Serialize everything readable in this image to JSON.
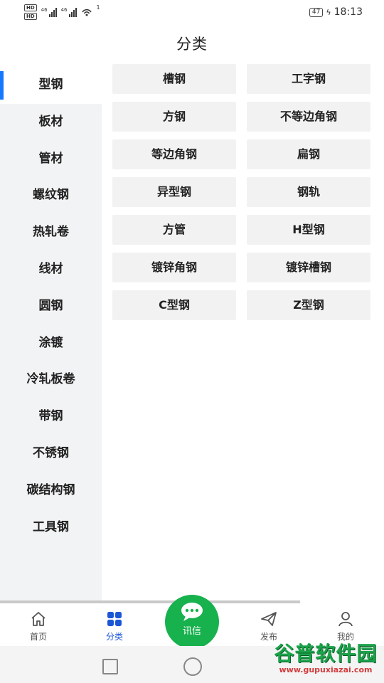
{
  "status_bar": {
    "hd1": "HD",
    "hd2": "HD",
    "sim1": "46",
    "sim2": "46",
    "wifi_badge": "1",
    "battery": "47",
    "time": "18:13"
  },
  "header": {
    "title": "分类"
  },
  "sidebar": {
    "items": [
      {
        "label": "型钢",
        "active": true
      },
      {
        "label": "板材"
      },
      {
        "label": "管材"
      },
      {
        "label": "螺纹钢"
      },
      {
        "label": "热轧卷"
      },
      {
        "label": "线材"
      },
      {
        "label": "圆钢"
      },
      {
        "label": "涂镀"
      },
      {
        "label": "冷轧板卷"
      },
      {
        "label": "带钢"
      },
      {
        "label": "不锈钢"
      },
      {
        "label": "碳结构钢"
      },
      {
        "label": "工具钢"
      }
    ]
  },
  "subcategories": [
    "槽钢",
    "工字钢",
    "方钢",
    "不等边角钢",
    "等边角钢",
    "扁钢",
    "异型钢",
    "钢轨",
    "方管",
    "H型钢",
    "镀锌角钢",
    "镀锌槽钢",
    "C型钢",
    "Z型钢"
  ],
  "bottom_nav": {
    "home": {
      "label": "首页",
      "icon": "home-icon"
    },
    "category": {
      "label": "分类",
      "icon": "grid-icon",
      "color": "#1a56d6"
    },
    "message": {
      "label": "讯信",
      "icon": "chat-icon",
      "color": "#17b14d"
    },
    "publish": {
      "label": "发布",
      "icon": "paper-plane-icon"
    },
    "mine": {
      "label": "我的",
      "icon": "user-icon"
    }
  },
  "watermark": {
    "title": "谷普软件园",
    "url": "www.gupuxiazai.com"
  },
  "colors": {
    "accent": "#1677ff",
    "sidebar_bg": "#f2f3f4",
    "cell_bg": "#f2f2f2",
    "green": "#17b14d"
  }
}
